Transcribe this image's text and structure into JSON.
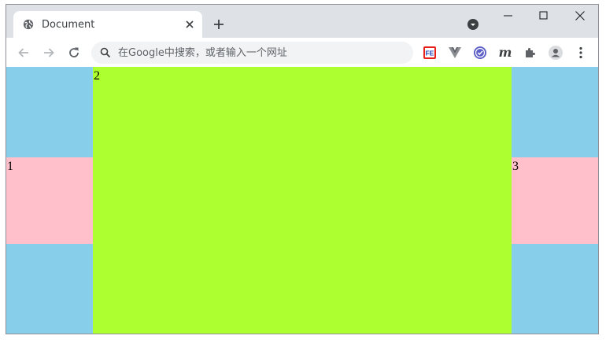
{
  "tab": {
    "title": "Document",
    "favicon": "globe-icon"
  },
  "toolbar": {
    "omnibox_placeholder": "在Google中搜索，或者输入一个网址",
    "extensions": [
      "fe-extension-icon",
      "vue-devtools-icon",
      "check-extension-icon",
      "m-extension-icon",
      "puzzle-icon",
      "profile-icon",
      "more-vert-icon"
    ]
  },
  "page": {
    "cell1_label": "1",
    "cell2_label": "2",
    "cell3_label": "3",
    "colors": {
      "background": "#87ceeb",
      "side_cells": "#ffc0cb",
      "center": "#adff2f"
    }
  }
}
